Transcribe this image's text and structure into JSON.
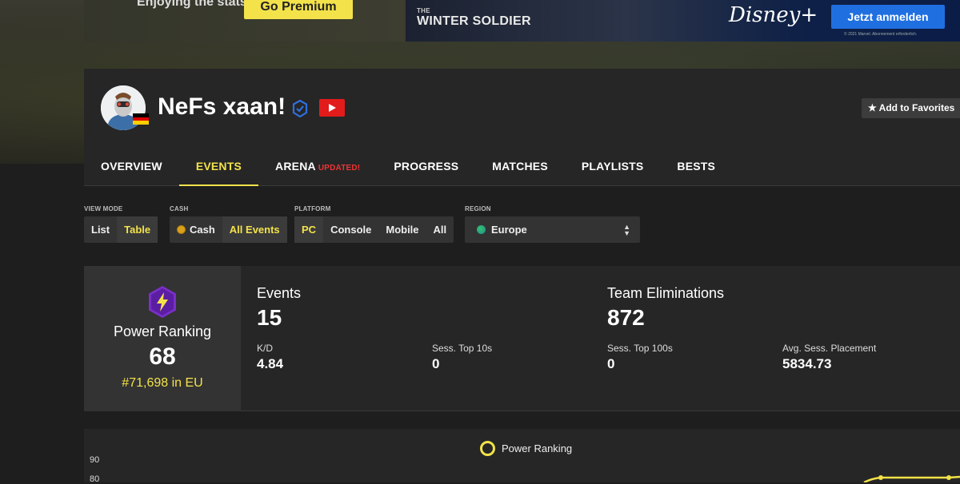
{
  "ad": {
    "left_text": "Enjoying the stats?",
    "left_button": "Go Premium",
    "show_title": "WINTER SOLDIER",
    "show_prefix": "THE",
    "brand": "Disney+",
    "cta": "Jetzt anmelden",
    "fine_print": "© 2021 Marvel. Abonnement erforderlich."
  },
  "profile": {
    "name": "NeFs xaan!",
    "favorite_button": "★ Add to Favorites",
    "flag_colors": [
      "#000000",
      "#dd0000",
      "#ffce00"
    ]
  },
  "tabs": [
    {
      "label": "OVERVIEW"
    },
    {
      "label": "EVENTS",
      "active": true
    },
    {
      "label": "ARENA",
      "badge": "UPDATED!"
    },
    {
      "label": "PROGRESS"
    },
    {
      "label": "MATCHES"
    },
    {
      "label": "PLAYLISTS"
    },
    {
      "label": "BESTS"
    }
  ],
  "filters": {
    "view_mode": {
      "label": "VIEW MODE",
      "options": [
        "List",
        "Table"
      ],
      "selected": "Table"
    },
    "cash": {
      "label": "CASH",
      "options": [
        "Cash",
        "All Events"
      ],
      "selected": "All Events"
    },
    "platform": {
      "label": "PLATFORM",
      "options": [
        "PC",
        "Console",
        "Mobile",
        "All"
      ],
      "selected": "PC"
    },
    "region": {
      "label": "REGION",
      "value": "Europe"
    }
  },
  "power_ranking": {
    "label": "Power Ranking",
    "value": "68",
    "sub": "#71,698 in EU"
  },
  "stats": {
    "events": {
      "label": "Events",
      "value": "15"
    },
    "team_elims": {
      "label": "Team Eliminations",
      "value": "872"
    },
    "kd": {
      "label": "K/D",
      "value": "4.84"
    },
    "sess_top10": {
      "label": "Sess. Top 10s",
      "value": "0"
    },
    "sess_top100": {
      "label": "Sess. Top 100s",
      "value": "0"
    },
    "avg_placement": {
      "label": "Avg. Sess. Placement",
      "value": "5834.73"
    }
  },
  "chart_data": {
    "type": "line",
    "series": [
      {
        "name": "Power Ranking",
        "color": "#f3e24a"
      }
    ],
    "yticks": [
      "90",
      "80"
    ]
  },
  "colors": {
    "accent": "#f3e24a",
    "updated_badge": "#ee3333",
    "youtube": "#e21b1b",
    "verified": "#2f6fe0"
  }
}
